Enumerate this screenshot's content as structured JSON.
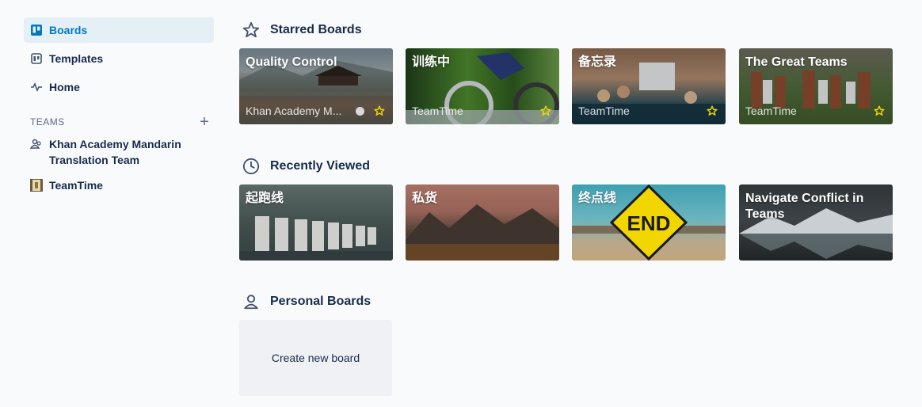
{
  "sidebar": {
    "nav": [
      {
        "label": "Boards",
        "icon": "boards-icon"
      },
      {
        "label": "Templates",
        "icon": "templates-icon"
      },
      {
        "label": "Home",
        "icon": "home-activity-icon"
      }
    ],
    "teams_label": "TEAMS",
    "add_team_icon": "plus-icon",
    "teams": [
      {
        "name": "Khan Academy Mandarin Translation Team",
        "icon": "team-people-icon"
      },
      {
        "name": "TeamTime",
        "icon": "team-avatar-icon"
      }
    ]
  },
  "sections": {
    "starred": {
      "title": "Starred Boards",
      "icon": "star-outline-icon"
    },
    "recent": {
      "title": "Recently Viewed",
      "icon": "clock-icon"
    },
    "personal": {
      "title": "Personal Boards",
      "icon": "person-icon"
    }
  },
  "starred_boards": [
    {
      "title": "Quality Control",
      "team": "Khan Academy M...",
      "starred": true
    },
    {
      "title": "训练中",
      "team": "TeamTime",
      "starred": true
    },
    {
      "title": "备忘录",
      "team": "TeamTime",
      "starred": true
    },
    {
      "title": "The Great Teams",
      "team": "TeamTime",
      "starred": true
    }
  ],
  "recent_boards": [
    {
      "title": "起跑线"
    },
    {
      "title": "私货"
    },
    {
      "title": "终点线",
      "sign_text": "END"
    },
    {
      "title": "Navigate Conflict in Teams"
    }
  ],
  "personal": {
    "create_label": "Create new board"
  },
  "colors": {
    "active_bg": "#e4f0f6",
    "active_text": "#0079bf",
    "star": "#f2d600"
  }
}
